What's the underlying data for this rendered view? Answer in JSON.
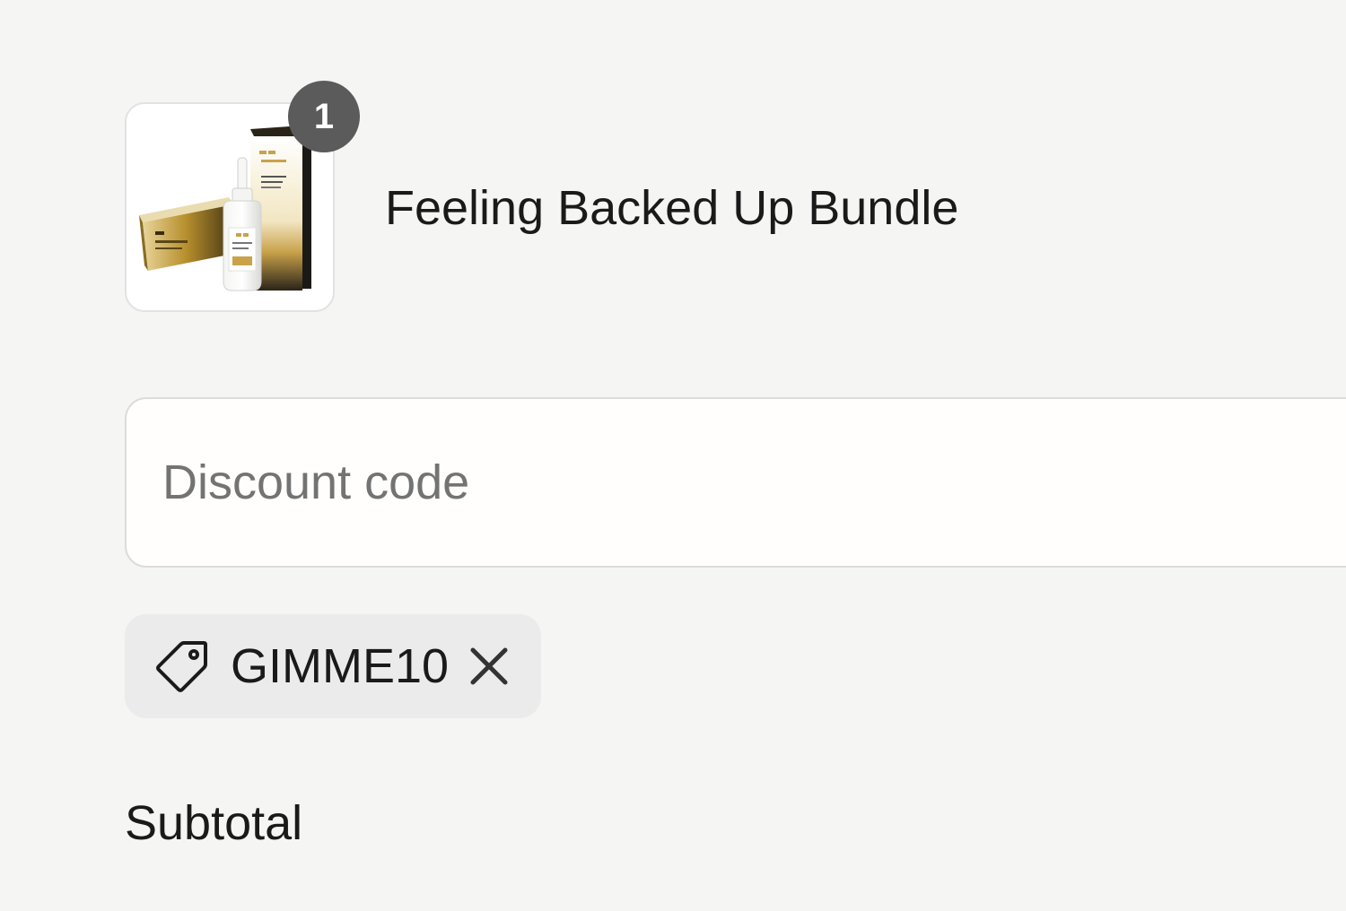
{
  "line_item": {
    "quantity": "1",
    "title": "Feeling Backed Up Bundle",
    "thumbnail_icon": "product-bundle-image"
  },
  "discount": {
    "placeholder": "Discount code",
    "value": ""
  },
  "applied_code": {
    "icon": "tag-icon",
    "code": "GIMME10",
    "remove_icon": "close-icon"
  },
  "totals": {
    "subtotal_label": "Subtotal"
  },
  "colors": {
    "background": "#f5f5f4",
    "badge": "#5b5b5b",
    "chip": "#ebebeb",
    "product_gold": "#c9a24a"
  }
}
